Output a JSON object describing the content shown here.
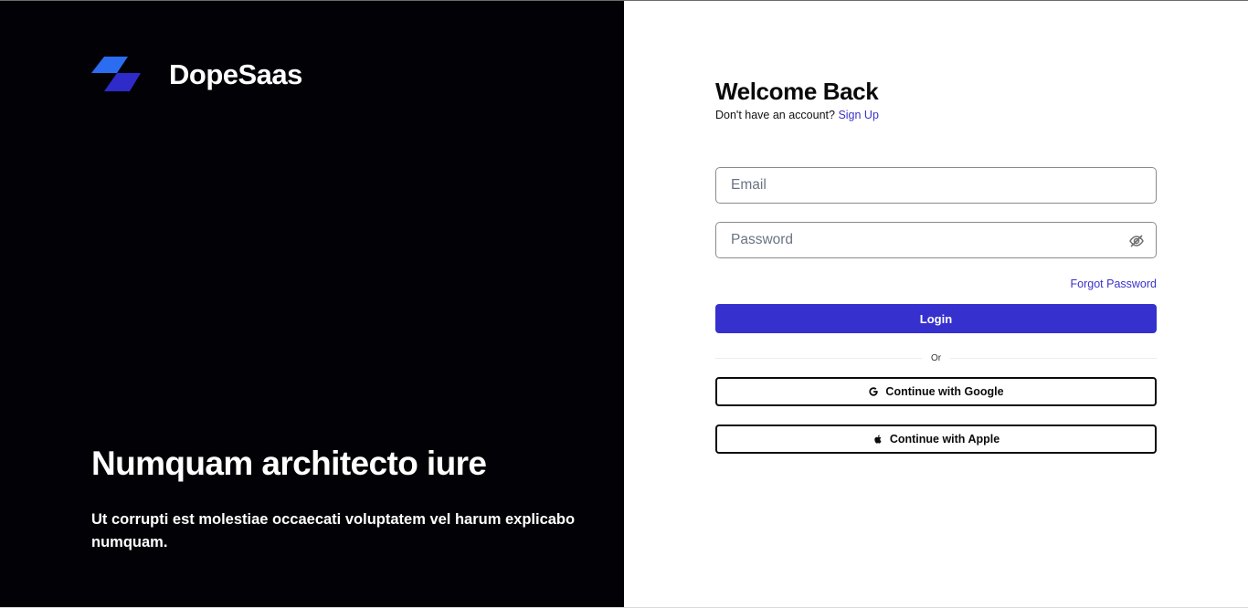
{
  "brand": {
    "name": "DopeSaas",
    "logo_icon": "parallelogram-stack-logo",
    "logo_colors": [
      "#2b6cf0",
      "#2f2bc9"
    ]
  },
  "hero": {
    "title": "Numquam architecto iure",
    "subtitle": "Ut corrupti est molestiae occaecati voluptatem vel harum explicabo numquam."
  },
  "form": {
    "heading": "Welcome Back",
    "signup_prompt": "Don't have an account?",
    "signup_link": "Sign Up",
    "email_placeholder": "Email",
    "password_placeholder": "Password",
    "password_toggle_icon": "eye-off-icon",
    "forgot_password": "Forgot Password",
    "login_label": "Login",
    "divider_text": "Or",
    "google_label": "Continue with Google",
    "google_icon": "google-icon",
    "apple_label": "Continue with Apple",
    "apple_icon": "apple-icon"
  },
  "colors": {
    "left_background": "#020206",
    "accent": "#3630cf",
    "link": "#3b32c8"
  }
}
